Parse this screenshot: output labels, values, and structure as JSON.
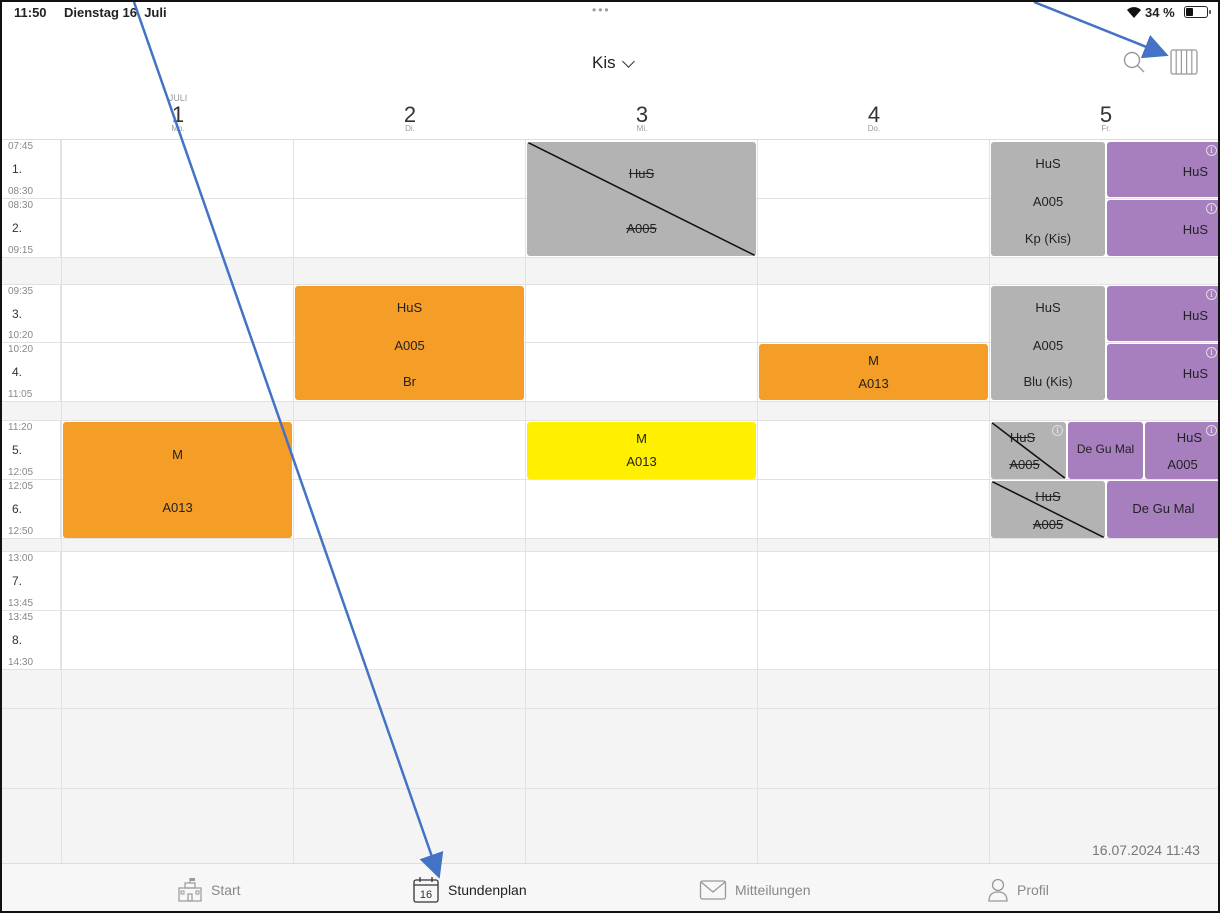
{
  "status": {
    "time": "11:50",
    "date": "Dienstag 16. Juli",
    "battery": "34 %"
  },
  "nav": {
    "title": "Kis"
  },
  "days": [
    {
      "month": "JULI",
      "num": "1",
      "wd": "Mo."
    },
    {
      "month": "",
      "num": "2",
      "wd": "Di."
    },
    {
      "month": "",
      "num": "3",
      "wd": "Mi."
    },
    {
      "month": "",
      "num": "4",
      "wd": "Do."
    },
    {
      "month": "",
      "num": "5",
      "wd": "Fr."
    }
  ],
  "periods": [
    {
      "start": "07:45",
      "num": "1.",
      "end": "08:30"
    },
    {
      "start": "08:30",
      "num": "2.",
      "end": "09:15"
    },
    {
      "start": "09:35",
      "num": "3.",
      "end": "10:20"
    },
    {
      "start": "10:20",
      "num": "4.",
      "end": "11:05"
    },
    {
      "start": "11:20",
      "num": "5.",
      "end": "12:05"
    },
    {
      "start": "12:05",
      "num": "6.",
      "end": "12:50"
    },
    {
      "start": "13:00",
      "num": "7.",
      "end": "13:45"
    },
    {
      "start": "13:45",
      "num": "8.",
      "end": "14:30"
    }
  ],
  "lessons": {
    "wed_p12": {
      "subject": "HuS",
      "room": "A005"
    },
    "fri_p12_grey": {
      "subject": "HuS",
      "room": "A005",
      "teacher": "Kp (Kis)"
    },
    "fri_p1_purple": {
      "subject": "HuS"
    },
    "fri_p2_purple": {
      "subject": "HuS"
    },
    "tue_p34": {
      "subject": "HuS",
      "room": "A005",
      "teacher": "Br"
    },
    "thu_p4": {
      "subject": "M",
      "room": "A013"
    },
    "fri_p34_grey": {
      "subject": "HuS",
      "room": "A005",
      "teacher": "Blu (Kis)"
    },
    "fri_p3_purple": {
      "subject": "HuS"
    },
    "fri_p4_purple": {
      "subject": "HuS"
    },
    "mon_p56": {
      "subject": "M",
      "room": "A013"
    },
    "wed_p5": {
      "subject": "M",
      "room": "A013"
    },
    "fri_p5_grey": {
      "subject": "HuS",
      "room": "A005"
    },
    "fri_p5_purple_a": {
      "subject": "De Gu Mal"
    },
    "fri_p5_purple_b": {
      "subject": "HuS",
      "room": "A005"
    },
    "fri_p6_grey": {
      "subject": "HuS",
      "room": "A005"
    },
    "fri_p6_purple": {
      "subject": "De Gu Mal"
    }
  },
  "timestamp": "16.07.2024 11:43",
  "tabs": [
    {
      "label": "Start"
    },
    {
      "label": "Stundenplan",
      "icon_num": "16"
    },
    {
      "label": "Mitteilungen"
    },
    {
      "label": "Profil"
    }
  ],
  "colors": {
    "orange": "#f49d27",
    "yellow": "#fff000",
    "grey": "#b3b3b3",
    "purple": "#a77fbf",
    "arrow": "#4472c4"
  }
}
